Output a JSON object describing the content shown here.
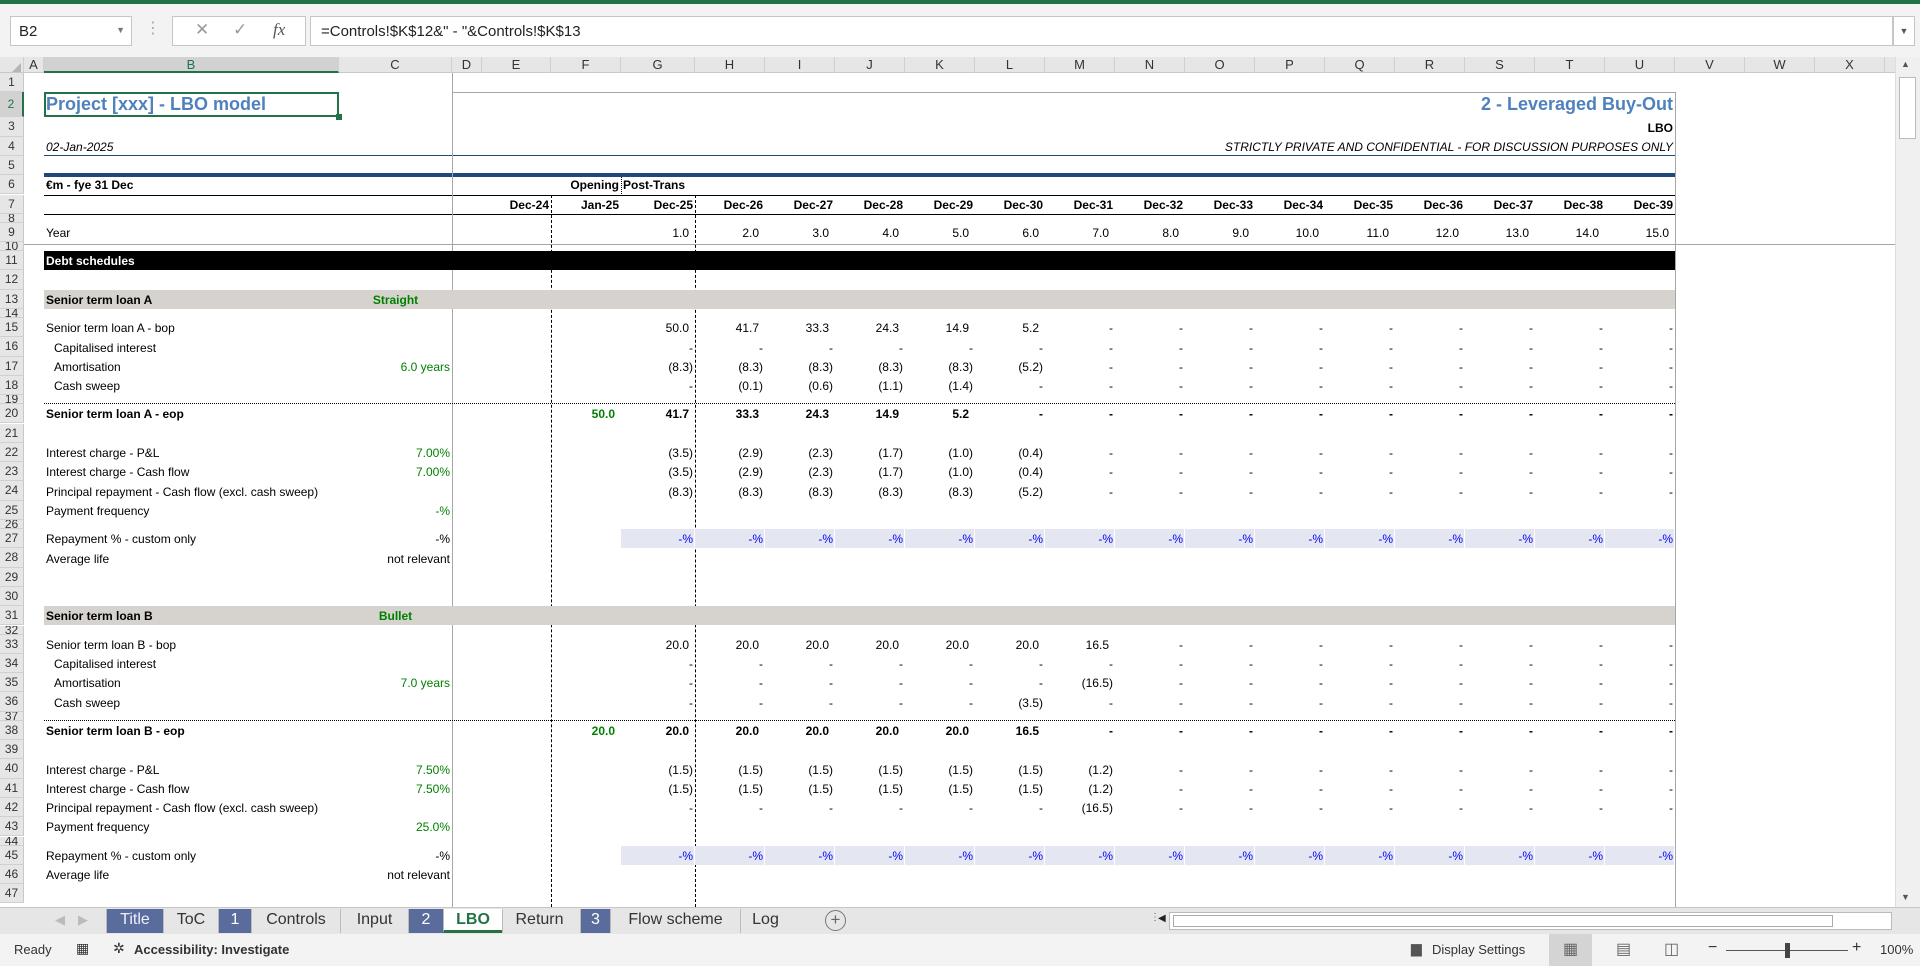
{
  "colors": {
    "accent": "#217346",
    "title_blue": "#4f81bd",
    "input_green": "#008000",
    "section_gray": "#d6d3ce",
    "custom_bg": "#e4e7f1",
    "custom_text": "#0000ff",
    "divider_blue": "#1f497d"
  },
  "formula_bar": {
    "name_box": "B2",
    "cancel_icon": "✕",
    "enter_icon": "✓",
    "fx_icon": "fx",
    "formula": "=Controls!$K$12&\" - \"&Controls!$K$13"
  },
  "columns": [
    "A",
    "B",
    "C",
    "D",
    "E",
    "F",
    "G",
    "H",
    "I",
    "J",
    "K",
    "L",
    "M",
    "N",
    "O",
    "P",
    "Q",
    "R",
    "S",
    "T",
    "U",
    "V",
    "W",
    "X"
  ],
  "rows": [
    "1",
    "2",
    "3",
    "4",
    "5",
    "6",
    "7",
    "8",
    "9",
    "10",
    "11",
    "12",
    "13",
    "14",
    "15",
    "16",
    "17",
    "18",
    "19",
    "20",
    "21",
    "22",
    "23",
    "24",
    "25",
    "26",
    "27",
    "28",
    "29",
    "30",
    "31",
    "32",
    "33",
    "34",
    "35",
    "36",
    "37",
    "38",
    "39",
    "40",
    "41",
    "42",
    "43",
    "44",
    "45",
    "46",
    "47"
  ],
  "header": {
    "title": "Project [xxx]  - LBO model",
    "section_title": "2 - Leveraged Buy-Out",
    "sheet_code": "LBO",
    "date": "02-Jan-2025",
    "confidential": "STRICTLY PRIVATE AND CONFIDENTIAL - FOR DISCUSSION PURPOSES ONLY",
    "units": "€m - fye 31 Dec",
    "opening": "Opening",
    "post_trans": "Post-Trans",
    "year_label": "Year"
  },
  "periods": [
    "Dec-24",
    "Jan-25",
    "Dec-25",
    "Dec-26",
    "Dec-27",
    "Dec-28",
    "Dec-29",
    "Dec-30",
    "Dec-31",
    "Dec-32",
    "Dec-33",
    "Dec-34",
    "Dec-35",
    "Dec-36",
    "Dec-37",
    "Dec-38",
    "Dec-39"
  ],
  "years": [
    "1.0",
    "2.0",
    "3.0",
    "4.0",
    "5.0",
    "6.0",
    "7.0",
    "8.0",
    "9.0",
    "10.0",
    "11.0",
    "12.0",
    "13.0",
    "14.0",
    "15.0"
  ],
  "section": "Debt schedules",
  "loan_a": {
    "name": "Senior term loan A",
    "type": "Straight",
    "bop": {
      "label": "Senior term loan A - bop",
      "values": [
        "50.0",
        "41.7",
        "33.3",
        "24.3",
        "14.9",
        "5.2",
        "-",
        "-",
        "-",
        "-",
        "-",
        "-",
        "-",
        "-",
        "-"
      ]
    },
    "cap_int": {
      "label": "Capitalised interest",
      "values": [
        "-",
        "-",
        "-",
        "-",
        "-",
        "-",
        "-",
        "-",
        "-",
        "-",
        "-",
        "-",
        "-",
        "-",
        "-"
      ]
    },
    "amort": {
      "label": "Amortisation",
      "input": "6.0 years",
      "values": [
        "(8.3)",
        "(8.3)",
        "(8.3)",
        "(8.3)",
        "(8.3)",
        "(5.2)",
        "-",
        "-",
        "-",
        "-",
        "-",
        "-",
        "-",
        "-",
        "-"
      ]
    },
    "sweep": {
      "label": "Cash sweep",
      "values": [
        "-",
        "(0.1)",
        "(0.6)",
        "(1.1)",
        "(1.4)",
        "-",
        "-",
        "-",
        "-",
        "-",
        "-",
        "-",
        "-",
        "-",
        "-"
      ]
    },
    "eop": {
      "label": "Senior term loan A - eop",
      "opening": "50.0",
      "values": [
        "41.7",
        "33.3",
        "24.3",
        "14.9",
        "5.2",
        "-",
        "-",
        "-",
        "-",
        "-",
        "-",
        "-",
        "-",
        "-",
        "-"
      ]
    },
    "int_pl": {
      "label": "Interest charge - P&L",
      "input": "7.00%",
      "values": [
        "(3.5)",
        "(2.9)",
        "(2.3)",
        "(1.7)",
        "(1.0)",
        "(0.4)",
        "-",
        "-",
        "-",
        "-",
        "-",
        "-",
        "-",
        "-",
        "-"
      ]
    },
    "int_cf": {
      "label": "Interest charge - Cash flow",
      "input": "7.00%",
      "values": [
        "(3.5)",
        "(2.9)",
        "(2.3)",
        "(1.7)",
        "(1.0)",
        "(0.4)",
        "-",
        "-",
        "-",
        "-",
        "-",
        "-",
        "-",
        "-",
        "-"
      ]
    },
    "principal": {
      "label": "Principal repayment - Cash flow (excl. cash sweep)",
      "values": [
        "(8.3)",
        "(8.3)",
        "(8.3)",
        "(8.3)",
        "(8.3)",
        "(5.2)",
        "-",
        "-",
        "-",
        "-",
        "-",
        "-",
        "-",
        "-",
        "-"
      ]
    },
    "freq": {
      "label": "Payment frequency",
      "input": "-%"
    },
    "repay": {
      "label": "Repayment % - custom only",
      "input": "-%",
      "values": [
        "-%",
        "-%",
        "-%",
        "-%",
        "-%",
        "-%",
        "-%",
        "-%",
        "-%",
        "-%",
        "-%",
        "-%",
        "-%",
        "-%",
        "-%"
      ]
    },
    "life": {
      "label": "Average life",
      "input": "not relevant"
    }
  },
  "loan_b": {
    "name": "Senior term loan B",
    "type": "Bullet",
    "bop": {
      "label": "Senior term loan B - bop",
      "values": [
        "20.0",
        "20.0",
        "20.0",
        "20.0",
        "20.0",
        "20.0",
        "16.5",
        "-",
        "-",
        "-",
        "-",
        "-",
        "-",
        "-",
        "-"
      ]
    },
    "cap_int": {
      "label": "Capitalised interest",
      "values": [
        "-",
        "-",
        "-",
        "-",
        "-",
        "-",
        "-",
        "-",
        "-",
        "-",
        "-",
        "-",
        "-",
        "-",
        "-"
      ]
    },
    "amort": {
      "label": "Amortisation",
      "input": "7.0 years",
      "values": [
        "-",
        "-",
        "-",
        "-",
        "-",
        "-",
        "(16.5)",
        "-",
        "-",
        "-",
        "-",
        "-",
        "-",
        "-",
        "-"
      ]
    },
    "sweep": {
      "label": "Cash sweep",
      "values": [
        "-",
        "-",
        "-",
        "-",
        "-",
        "(3.5)",
        "-",
        "-",
        "-",
        "-",
        "-",
        "-",
        "-",
        "-",
        "-"
      ]
    },
    "eop": {
      "label": "Senior term loan B - eop",
      "opening": "20.0",
      "values": [
        "20.0",
        "20.0",
        "20.0",
        "20.0",
        "20.0",
        "16.5",
        "-",
        "-",
        "-",
        "-",
        "-",
        "-",
        "-",
        "-",
        "-"
      ]
    },
    "int_pl": {
      "label": "Interest charge - P&L",
      "input": "7.50%",
      "values": [
        "(1.5)",
        "(1.5)",
        "(1.5)",
        "(1.5)",
        "(1.5)",
        "(1.5)",
        "(1.2)",
        "-",
        "-",
        "-",
        "-",
        "-",
        "-",
        "-",
        "-"
      ]
    },
    "int_cf": {
      "label": "Interest charge - Cash flow",
      "input": "7.50%",
      "values": [
        "(1.5)",
        "(1.5)",
        "(1.5)",
        "(1.5)",
        "(1.5)",
        "(1.5)",
        "(1.2)",
        "-",
        "-",
        "-",
        "-",
        "-",
        "-",
        "-",
        "-"
      ]
    },
    "principal": {
      "label": "Principal repayment - Cash flow (excl. cash sweep)",
      "values": [
        "-",
        "-",
        "-",
        "-",
        "-",
        "-",
        "(16.5)",
        "-",
        "-",
        "-",
        "-",
        "-",
        "-",
        "-",
        "-"
      ]
    },
    "freq": {
      "label": "Payment frequency",
      "input": "25.0%"
    },
    "repay": {
      "label": "Repayment % - custom only",
      "input": "-%",
      "values": [
        "-%",
        "-%",
        "-%",
        "-%",
        "-%",
        "-%",
        "-%",
        "-%",
        "-%",
        "-%",
        "-%",
        "-%",
        "-%",
        "-%",
        "-%"
      ]
    },
    "life": {
      "label": "Average life",
      "input": "not relevant"
    }
  },
  "tabs": [
    {
      "label": "Title",
      "style": "tblue"
    },
    {
      "label": "ToC",
      "style": ""
    },
    {
      "label": "1",
      "style": "num"
    },
    {
      "label": "Controls",
      "style": ""
    },
    {
      "label": "Input",
      "style": ""
    },
    {
      "label": "2",
      "style": "num"
    },
    {
      "label": "LBO",
      "style": "act"
    },
    {
      "label": "Return",
      "style": ""
    },
    {
      "label": "3",
      "style": "num"
    },
    {
      "label": "Flow scheme",
      "style": ""
    },
    {
      "label": "Log",
      "style": ""
    }
  ],
  "status": {
    "ready": "Ready",
    "accessibility": "Accessibility: Investigate",
    "display_settings": "Display Settings",
    "zoom": "100%",
    "zoom_level_percent": 100
  }
}
